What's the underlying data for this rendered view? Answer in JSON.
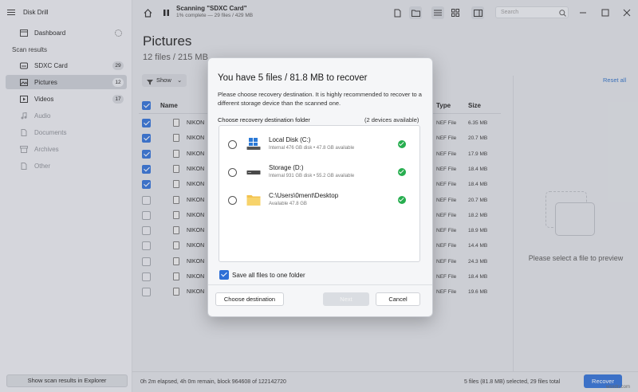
{
  "app": {
    "title": "Disk Drill"
  },
  "sidebar": {
    "dashboard": "Dashboard",
    "section_title": "Scan results",
    "items": [
      {
        "label": "SDXC Card",
        "count": "29",
        "icon": "sd-card-icon",
        "selected": false,
        "dim": false
      },
      {
        "label": "Pictures",
        "count": "12",
        "icon": "image-icon",
        "selected": true,
        "dim": false
      },
      {
        "label": "Videos",
        "count": "17",
        "icon": "video-icon",
        "selected": false,
        "dim": false
      },
      {
        "label": "Audio",
        "count": "",
        "icon": "music-icon",
        "selected": false,
        "dim": true
      },
      {
        "label": "Documents",
        "count": "",
        "icon": "document-icon",
        "selected": false,
        "dim": true
      },
      {
        "label": "Archives",
        "count": "",
        "icon": "archive-icon",
        "selected": false,
        "dim": true
      },
      {
        "label": "Other",
        "count": "",
        "icon": "other-file-icon",
        "selected": false,
        "dim": true
      }
    ],
    "footer_button": "Show scan results in Explorer"
  },
  "toolbar": {
    "scan_title": "Scanning \"SDXC Card\"",
    "scan_sub": "1% complete — 29 files / 429 MB",
    "search_placeholder": "Search"
  },
  "main": {
    "title": "Pictures",
    "subtitle": "12 files / 215 MB",
    "show_label": "Show",
    "reset_all": "Reset all",
    "columns": {
      "name": "Name",
      "type": "Type",
      "size": "Size"
    },
    "rows": [
      {
        "name": "NIKON",
        "type": "NEF File",
        "size": "6.35 MB",
        "checked": true
      },
      {
        "name": "NIKON",
        "type": "NEF File",
        "size": "20.7 MB",
        "checked": true
      },
      {
        "name": "NIKON",
        "type": "NEF File",
        "size": "17.9 MB",
        "checked": true
      },
      {
        "name": "NIKON",
        "type": "NEF File",
        "size": "18.4 MB",
        "checked": true
      },
      {
        "name": "NIKON",
        "type": "NEF File",
        "size": "18.4 MB",
        "checked": true
      },
      {
        "name": "NIKON",
        "type": "NEF File",
        "size": "20.7 MB",
        "checked": false
      },
      {
        "name": "NIKON",
        "type": "NEF File",
        "size": "18.2 MB",
        "checked": false
      },
      {
        "name": "NIKON",
        "type": "NEF File",
        "size": "18.9 MB",
        "checked": false
      },
      {
        "name": "NIKON",
        "type": "NEF File",
        "size": "14.4 MB",
        "checked": false
      },
      {
        "name": "NIKON",
        "type": "NEF File",
        "size": "24.3 MB",
        "checked": false
      },
      {
        "name": "NIKON",
        "type": "NEF File",
        "size": "18.4 MB",
        "checked": false
      },
      {
        "name": "NIKON",
        "type": "NEF File",
        "size": "19.6 MB",
        "checked": false
      }
    ],
    "preview_text": "Please select a file to preview"
  },
  "status": {
    "left": "0h 2m elapsed, 4h 0m remain, block 964608 of 122142720",
    "right": "5 files (81.8 MB) selected, 29 files total",
    "recover": "Recover"
  },
  "modal": {
    "title": "You have 5 files / 81.8 MB to recover",
    "description": "Please choose recovery destination. It is highly recommended to recover to a different storage device than the scanned one.",
    "choose_label": "Choose recovery destination folder",
    "devices_count": "(2 devices available)",
    "destinations": [
      {
        "name": "Local Disk (C:)",
        "info": "Internal 476 GB disk • 47.8 GB available",
        "icon": "windows-drive-icon"
      },
      {
        "name": "Storage (D:)",
        "info": "Internal 931 GB disk • 55.2 GB available",
        "icon": "hard-drive-icon"
      },
      {
        "name": "C:\\Users\\0ment\\Desktop",
        "info": "Available 47.8 GB",
        "icon": "folder-icon"
      }
    ],
    "save_all_label": "Save all files to one folder",
    "choose_destination": "Choose destination",
    "next": "Next",
    "cancel": "Cancel"
  },
  "watermark": "wsxdn.com",
  "colors": {
    "accent": "#2f6fd6",
    "success": "#27ae4f"
  }
}
